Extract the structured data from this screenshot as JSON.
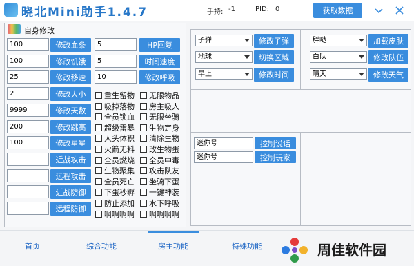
{
  "title": "晓北Mini助手1.4.7",
  "header": {
    "holding_label": "手持:",
    "holding_value": "-1",
    "pid_label": "PID:",
    "pid_value": "0",
    "fetch_label": "获取数据"
  },
  "self_panel": {
    "title": "自身修改",
    "left_rows": [
      {
        "value": "100",
        "button": "修改血条"
      },
      {
        "value": "100",
        "button": "修改饥饿"
      },
      {
        "value": "25",
        "button": "修改移速"
      },
      {
        "value": "2",
        "button": "修改大小"
      },
      {
        "value": "9999",
        "button": "修改天数"
      },
      {
        "value": "200",
        "button": "修改跳高"
      },
      {
        "value": "100",
        "button": "修改星星"
      },
      {
        "value": "",
        "button": "近战攻击"
      },
      {
        "value": "",
        "button": "远程攻击"
      },
      {
        "value": "",
        "button": "近战防御"
      },
      {
        "value": "",
        "button": "远程防御"
      }
    ],
    "mid_rows": [
      {
        "value": "5",
        "button": "HP回复"
      },
      {
        "value": "5",
        "button": "时间速度"
      },
      {
        "value": "10",
        "button": "修改呼吸"
      }
    ],
    "checkboxes_a": [
      "重生留物",
      "吸掉落物",
      "全员锁血",
      "超级雷暴",
      "人头体积",
      "火箭无料",
      "全员燃烧",
      "生物聚集",
      "全员死亡",
      "下蛋秒孵",
      "防止添加",
      "啊啊啊啊"
    ],
    "checkboxes_b": [
      "无限物品",
      "房主吸人",
      "无限坐骑",
      "生物定身",
      "清除生物",
      "改生物蛋",
      "全员中毒",
      "攻击队友",
      "坐骑下蛋",
      "一键神装",
      "水下呼吸",
      "啊啊啊啊"
    ]
  },
  "right_panel": {
    "selects": [
      {
        "value": "子弹",
        "button": "修改子弹"
      },
      {
        "value": "地球",
        "button": "切换区域"
      },
      {
        "value": "早上",
        "button": "修改时间"
      },
      {
        "value": "胖哒",
        "button": "加载皮肤"
      },
      {
        "value": "白队",
        "button": "修改队伍"
      },
      {
        "value": "晴天",
        "button": "修改天气"
      }
    ],
    "inputs": [
      {
        "value": "迷你号",
        "button": "控制说话"
      },
      {
        "value": "迷你号",
        "button": "控制玩家"
      }
    ]
  },
  "nav": {
    "tabs": [
      "首页",
      "综合功能",
      "房主功能",
      "特殊功能"
    ],
    "active": 2
  },
  "watermark": "周佳软件园",
  "colors": {
    "accent": "#3a8dde",
    "title": "#2777c8"
  }
}
